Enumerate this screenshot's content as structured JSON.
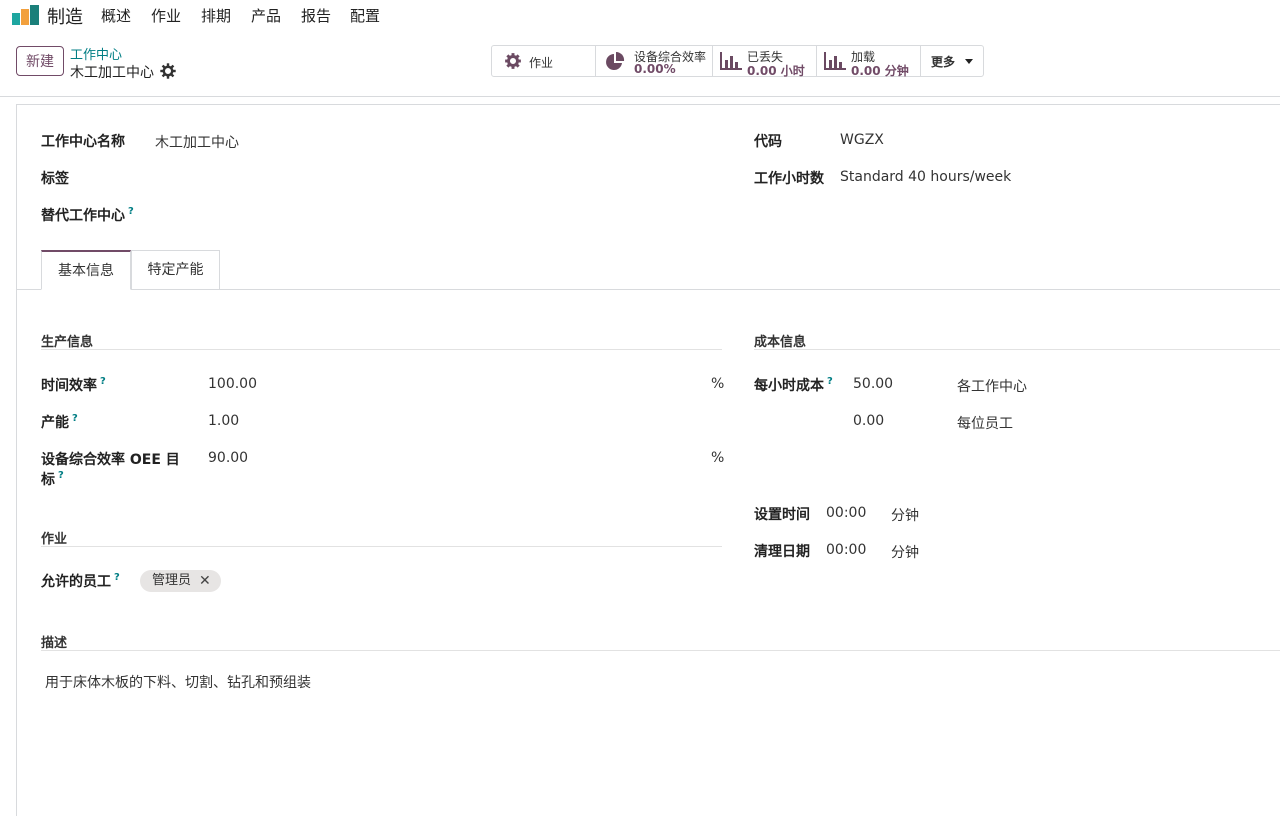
{
  "navbar": {
    "app_name": "制造",
    "menu": [
      "概述",
      "作业",
      "排期",
      "产品",
      "报告",
      "配置"
    ]
  },
  "control_panel": {
    "new_button": "新建",
    "breadcrumb": "工作中心",
    "record_title": "木工加工中心",
    "stats": {
      "operations": {
        "label": "作业"
      },
      "oee": {
        "label": "设备综合效率",
        "value": "0.00%"
      },
      "lost": {
        "label": "已丢失",
        "value": "0.00 小时"
      },
      "load": {
        "label": "加载",
        "value": "0.00 分钟"
      },
      "more": {
        "label": "更多"
      }
    }
  },
  "form": {
    "name_label": "工作中心名称",
    "name_value": "木工加工中心",
    "tags_label": "标签",
    "alt_label": "替代工作中心",
    "code_label": "代码",
    "code_value": "WGZX",
    "hours_label": "工作小时数",
    "hours_value": "Standard 40 hours/week",
    "help_mark": "?"
  },
  "tabs": [
    "基本信息",
    "特定产能"
  ],
  "production": {
    "section": "生产信息",
    "time_eff_label": "时间效率",
    "time_eff_value": "100.00",
    "time_eff_unit": "%",
    "capacity_label": "产能",
    "capacity_value": "1.00",
    "oee_target_label_1": "设备综合效率 OEE 目",
    "oee_target_label_2": "标",
    "oee_target_value": "90.00",
    "oee_target_unit": "%"
  },
  "cost": {
    "section": "成本信息",
    "hourly_label": "每小时成本",
    "hourly_value": "50.00",
    "hourly_suffix": "各工作中心",
    "employee_value": "0.00",
    "employee_suffix": "每位员工",
    "setup_label": "设置时间",
    "setup_value": "00:00",
    "setup_unit": "分钟",
    "cleanup_label": "清理日期",
    "cleanup_value": "00:00",
    "cleanup_unit": "分钟"
  },
  "operations": {
    "section": "作业",
    "allowed_label": "允许的员工",
    "tag": "管理员",
    "tag_remove": "✕"
  },
  "description": {
    "section": "描述",
    "text": "用于床体木板的下料、切割、钻孔和预组装"
  },
  "colors": {
    "brand": "#714b67",
    "link": "#017e84"
  }
}
